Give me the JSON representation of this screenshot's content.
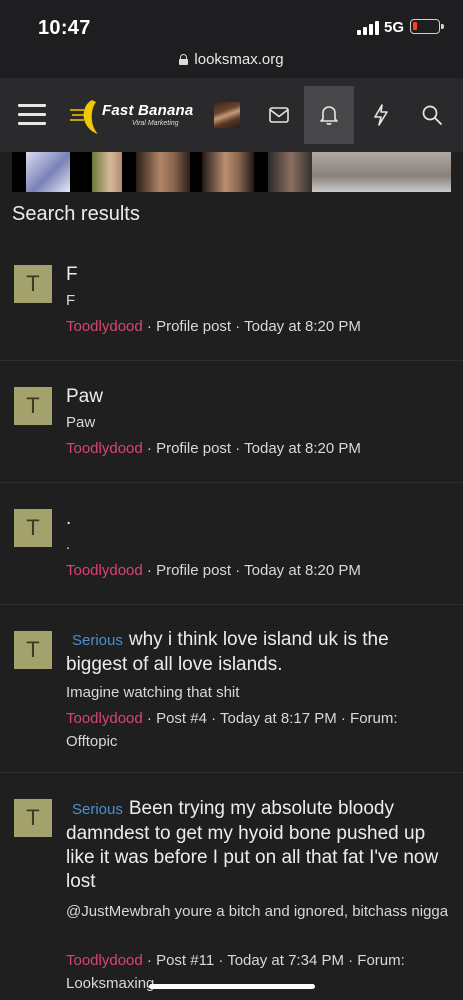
{
  "status": {
    "time": "10:47",
    "network": "5G"
  },
  "browser": {
    "url": "looksmax.org"
  },
  "nav": {
    "brand": "Fast Banana",
    "brand_sub": "Viral Marketing"
  },
  "page": {
    "heading": "Search results"
  },
  "results": [
    {
      "avatar": "T",
      "prefix": "",
      "title": "F",
      "snippet": "F",
      "user": "Toodlydood",
      "meta": " · Profile post · Today at 8:20 PM"
    },
    {
      "avatar": "T",
      "prefix": "",
      "title": "Paw",
      "snippet": "Paw",
      "user": "Toodlydood",
      "meta": " · Profile post · Today at 8:20 PM"
    },
    {
      "avatar": "T",
      "prefix": "",
      "title": ".",
      "snippet": ".",
      "user": "Toodlydood",
      "meta": " · Profile post · Today at 8:20 PM"
    },
    {
      "avatar": "T",
      "prefix": "Serious",
      "title": "why i think love island uk is the biggest of all love islands.",
      "snippet": "Imagine watching that shit",
      "user": "Toodlydood",
      "meta": " · Post #4 · Today at 8:17 PM · Forum: Offtopic"
    },
    {
      "avatar": "T",
      "prefix": "Serious",
      "title": "Been trying my absolute bloody damndest to get my hyoid bone pushed up like it was before I put on all that fat I've now lost",
      "snippet": "@JustMewbrah youre a bitch and ignored, bitchass nigga",
      "user": "Toodlydood",
      "meta": " · Post #11 · Today at 7:34 PM · Forum: Looksmaxing"
    }
  ],
  "colors": {
    "accent_user": "#d9446f",
    "prefix_blue": "#4a8fd1",
    "avatar_bg": "#a3a26c",
    "nav_bg": "#2a2a2c",
    "page_bg": "#1f1f1f"
  },
  "icons": [
    "menu-icon",
    "mail-icon",
    "bell-icon",
    "bolt-icon",
    "search-icon",
    "lock-icon"
  ]
}
